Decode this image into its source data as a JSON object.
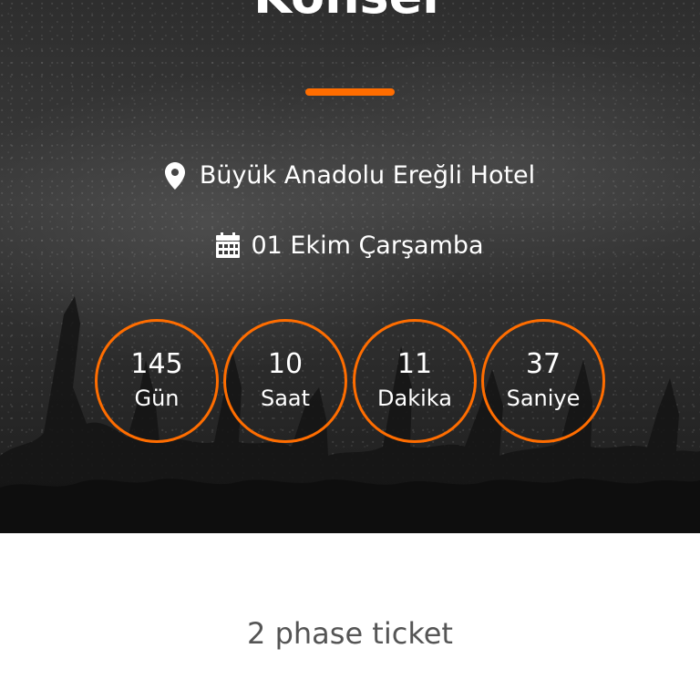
{
  "hero": {
    "title": "Konser",
    "venue": "Büyük Anadolu Ereğli Hotel",
    "date": "01 Ekim Çarşamba",
    "venue_icon": "location-pin-icon",
    "date_icon": "calendar-icon"
  },
  "countdown": [
    {
      "value": "145",
      "unit": "Gün"
    },
    {
      "value": "10",
      "unit": "Saat"
    },
    {
      "value": "11",
      "unit": "Dakika"
    },
    {
      "value": "37",
      "unit": "Saniye"
    }
  ],
  "tickets": {
    "heading": "2 phase ticket"
  },
  "colors": {
    "accent": "#ff6d00",
    "hero_bg": "#2e2e2e",
    "text_light": "#ffffff",
    "text_dark": "#555555"
  }
}
